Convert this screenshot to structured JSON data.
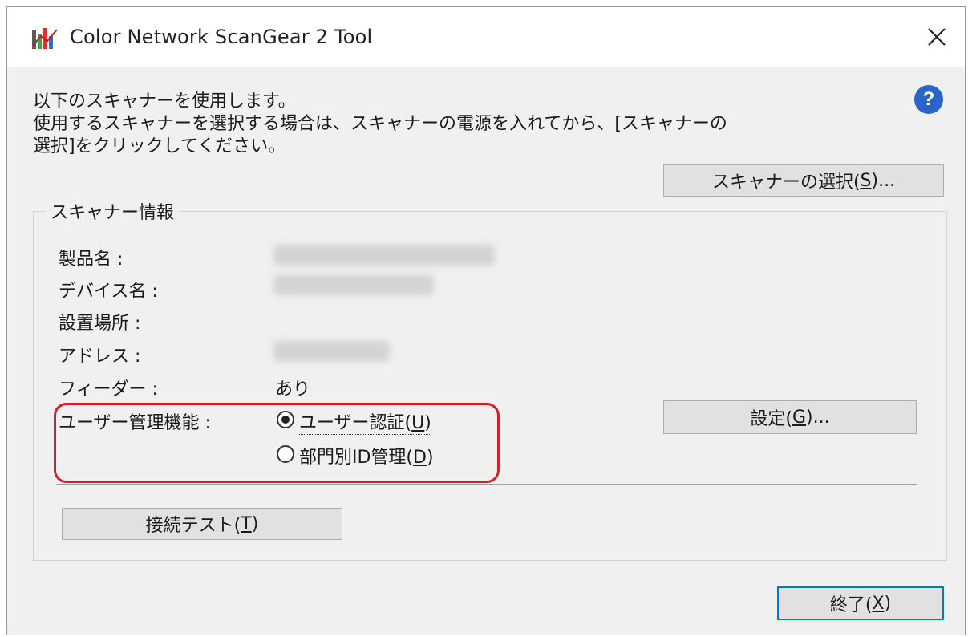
{
  "window": {
    "title": "Color Network ScanGear 2 Tool",
    "close_glyph": "✕"
  },
  "instructions": {
    "line1": "以下のスキャナーを使用します。",
    "line2": "使用するスキャナーを選択する場合は、スキャナーの電源を入れてから、[スキャナーの",
    "line3": "選択]をクリックしてください。"
  },
  "help": {
    "glyph": "?"
  },
  "buttons": {
    "select_scanner": {
      "prefix": "スキャナーの選択(",
      "mnemonic": "S",
      "suffix": ")..."
    },
    "settings": {
      "prefix": "設定(",
      "mnemonic": "G",
      "suffix": ")..."
    },
    "connection_test": {
      "prefix": "接続テスト(",
      "mnemonic": "T",
      "suffix": ")"
    },
    "exit": {
      "prefix": "終了(",
      "mnemonic": "X",
      "suffix": ")"
    }
  },
  "scanner_info": {
    "group_title": "スキャナー情報",
    "product_name_label": "製品名 :",
    "device_name_label": "デバイス名 :",
    "location_label": "設置場所 :",
    "address_label": "アドレス :",
    "feeder_label": "フィーダー :",
    "feeder_value": "あり",
    "user_mgmt_label": "ユーザー管理機能 :"
  },
  "user_management": {
    "options": [
      {
        "prefix": "ユーザー認証(",
        "mnemonic": "U",
        "suffix": ")",
        "selected": true
      },
      {
        "prefix": "部門別ID管理(",
        "mnemonic": "D",
        "suffix": ")",
        "selected": false
      }
    ]
  },
  "colors": {
    "highlight": "#d0202a",
    "default_button_border": "#0078d7",
    "help_icon": "#2b64c8"
  },
  "icons": {
    "app": "scangear-app-icon",
    "close": "close-icon",
    "help": "help-icon"
  }
}
